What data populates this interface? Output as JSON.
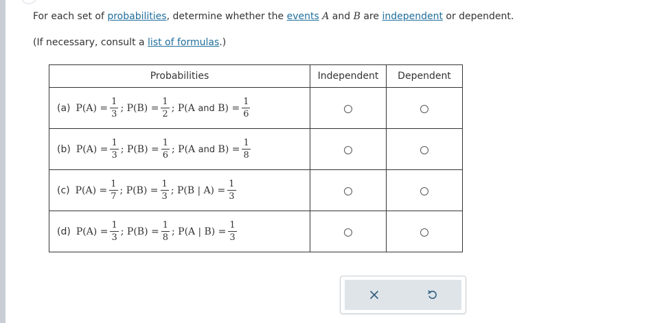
{
  "instructions": {
    "line1": {
      "t1": "For each set of ",
      "link_probabilities": "probabilities",
      "t2": ", determine whether the ",
      "link_events": "events",
      "var_a": "A",
      "t3": " and ",
      "var_b": "B",
      "t4": " are ",
      "link_independent": "independent",
      "t5": " or dependent."
    },
    "line2": {
      "t1": "(If necessary, consult a ",
      "link_formulas": "list of formulas",
      "t2": ".)"
    }
  },
  "table": {
    "headers": {
      "probabilities": "Probabilities",
      "independent": "Independent",
      "dependent": "Dependent"
    },
    "rows": [
      {
        "label": "(a)",
        "pa": {
          "num": "1",
          "den": "3"
        },
        "pb": {
          "num": "1",
          "den": "2"
        },
        "third": {
          "prefix": "P",
          "open": "(A ",
          "conn": "and",
          "close": " B)",
          "num": "1",
          "den": "6"
        }
      },
      {
        "label": "(b)",
        "pa": {
          "num": "1",
          "den": "3"
        },
        "pb": {
          "num": "1",
          "den": "6"
        },
        "third": {
          "prefix": "P",
          "open": "(A ",
          "conn": "and",
          "close": " B)",
          "num": "1",
          "den": "8"
        }
      },
      {
        "label": "(c)",
        "pa": {
          "num": "1",
          "den": "7"
        },
        "pb": {
          "num": "1",
          "den": "3"
        },
        "third": {
          "prefix": "P",
          "open": "(B ",
          "conn": "|",
          "close": " A)",
          "num": "1",
          "den": "3"
        }
      },
      {
        "label": "(d)",
        "pa": {
          "num": "1",
          "den": "3"
        },
        "pb": {
          "num": "1",
          "den": "8"
        },
        "third": {
          "prefix": "P",
          "open": "(A ",
          "conn": "|",
          "close": " B)",
          "num": "1",
          "den": "3"
        }
      }
    ],
    "math": {
      "pa": "P(A) =",
      "pb": "P(B) =",
      "sep": ";",
      "eq": "="
    }
  },
  "actions": {
    "clear_icon": "x-icon",
    "reset_icon": "undo-icon"
  },
  "colors": {
    "link": "#1f6e9c",
    "text": "#333333",
    "panel": "#dfe4e9",
    "icon": "#2f5d7c"
  }
}
